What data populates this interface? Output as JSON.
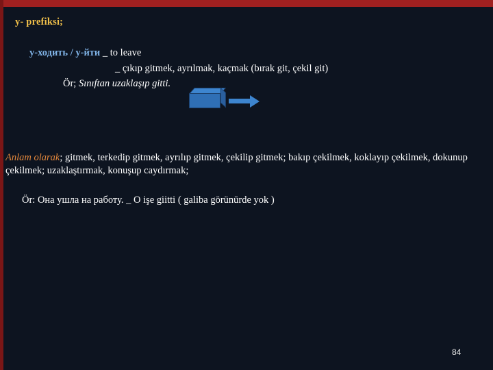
{
  "slide": {
    "title": "у-  prefiksi;",
    "line1_lead": "у-ходить  /  у-йти",
    "line1_rest": " _  to leave",
    "line2": "_  çıkıp gitmek, ayrılmak, kaçmak (bırak git, çekil git)",
    "line3_prefix": "Ör;",
    "line3_italic": "Sınıftan uzaklaşıp  gitti.",
    "anlam_label": "Anlam olarak",
    "anlam_text": ";  gitmek, terkedip gitmek, ayrılıp gitmek, çekilip gitmek;  bakıp çekilmek, koklayıp çekilmek, dokunup çekilmek; uzaklaştırmak, konuşup caydırmak;",
    "or_line": "Ör: Она ушла на работу. _  O işe giitti ( galiba görünürde yok )",
    "page_number": "84",
    "colors": {
      "background": "#0d1420",
      "top_bar": "#a02020",
      "title_text": "#f2c14a",
      "highlight_blue": "#7fb2e5",
      "accent_orange": "#e2873c",
      "graphic_blue": "#3d85cf"
    }
  }
}
